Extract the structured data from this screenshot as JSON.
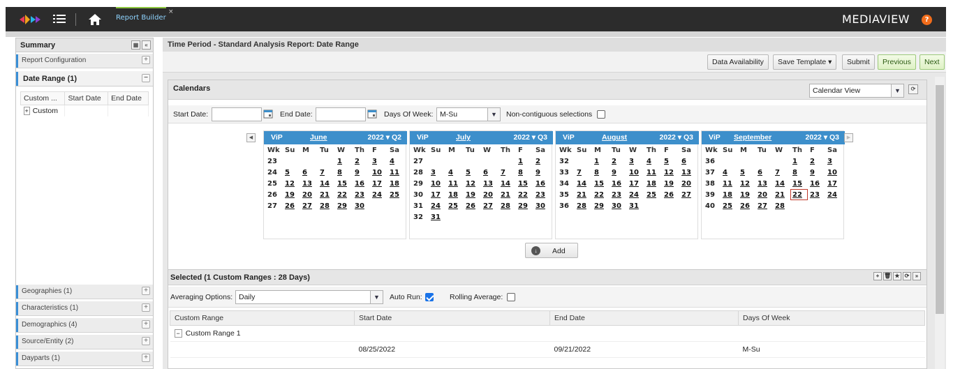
{
  "app": {
    "tab_label": "Report Builder",
    "tab_close": "×",
    "brand": "MEDIAVIEW",
    "help": "?"
  },
  "summary": {
    "title": "Summary",
    "report_config": "Report Configuration",
    "date_range": "Date Range (1)",
    "table_headers": [
      "Custom ...",
      "Start Date",
      "End Date"
    ],
    "table_row": "Custom",
    "sections": [
      "Geographies (1)",
      "Characteristics (1)",
      "Demographics (4)",
      "Source/Entity (2)",
      "Dayparts (1)"
    ]
  },
  "main": {
    "title": "Time Period - Standard Analysis Report: Date Range",
    "buttons": {
      "data_availability": "Data Availability",
      "save_template": "Save Template ▾",
      "submit": "Submit",
      "previous": "Previous",
      "next": "Next"
    }
  },
  "calendars": {
    "title": "Calendars",
    "view": "Calendar View",
    "start_label": "Start Date:",
    "end_label": "End Date:",
    "dow_label": "Days Of Week:",
    "dow_value": "M-Su",
    "noncontig_label": "Non-contiguous selections",
    "add_label": "Add",
    "day_headers": [
      "Wk",
      "Su",
      "M",
      "Tu",
      "W",
      "Th",
      "F",
      "Sa"
    ],
    "months": [
      {
        "vip": "ViP",
        "name": "June",
        "year": "2022 ▾ Q2",
        "weeks": [
          [
            "23",
            "",
            "",
            "",
            "1",
            "2",
            "3",
            "4"
          ],
          [
            "24",
            "5",
            "6",
            "7",
            "8",
            "9",
            "10",
            "11"
          ],
          [
            "25",
            "12",
            "13",
            "14",
            "15",
            "16",
            "17",
            "18"
          ],
          [
            "26",
            "19",
            "20",
            "21",
            "22",
            "23",
            "24",
            "25"
          ],
          [
            "27",
            "26",
            "27",
            "28",
            "29",
            "30",
            "",
            ""
          ]
        ]
      },
      {
        "vip": "ViP",
        "name": "July",
        "year": "2022 ▾ Q3",
        "weeks": [
          [
            "27",
            "",
            "",
            "",
            "",
            "",
            "1",
            "2"
          ],
          [
            "28",
            "3",
            "4",
            "5",
            "6",
            "7",
            "8",
            "9"
          ],
          [
            "29",
            "10",
            "11",
            "12",
            "13",
            "14",
            "15",
            "16"
          ],
          [
            "30",
            "17",
            "18",
            "19",
            "20",
            "21",
            "22",
            "23"
          ],
          [
            "31",
            "24",
            "25",
            "26",
            "27",
            "28",
            "29",
            "30"
          ],
          [
            "32",
            "31",
            "",
            "",
            "",
            "",
            "",
            ""
          ]
        ]
      },
      {
        "vip": "ViP",
        "name": "August",
        "year": "2022 ▾ Q3",
        "weeks": [
          [
            "32",
            "",
            "1",
            "2",
            "3",
            "4",
            "5",
            "6"
          ],
          [
            "33",
            "7",
            "8",
            "9",
            "10",
            "11",
            "12",
            "13"
          ],
          [
            "34",
            "14",
            "15",
            "16",
            "17",
            "18",
            "19",
            "20"
          ],
          [
            "35",
            "21",
            "22",
            "23",
            "24",
            "25",
            "26",
            "27"
          ],
          [
            "36",
            "28",
            "29",
            "30",
            "31",
            "",
            "",
            ""
          ]
        ]
      },
      {
        "vip": "ViP",
        "name": "September",
        "year": "2022 ▾ Q3",
        "weeks": [
          [
            "36",
            "",
            "",
            "",
            "",
            "1",
            "2",
            "3"
          ],
          [
            "37",
            "4",
            "5",
            "6",
            "7",
            "8",
            "9",
            "10"
          ],
          [
            "38",
            "11",
            "12",
            "13",
            "14",
            "15",
            "16",
            "17"
          ],
          [
            "39",
            "18",
            "19",
            "20",
            "21",
            "22",
            "23",
            "24"
          ],
          [
            "40",
            "25",
            "26",
            "27",
            "28",
            "",
            "",
            ""
          ]
        ]
      }
    ],
    "today_month": 3,
    "today_day": "22"
  },
  "selected": {
    "title": "Selected (1 Custom Ranges : 28 Days)",
    "avg_label": "Averaging Options:",
    "avg_value": "Daily",
    "autorun_label": "Auto Run:",
    "rolling_label": "Rolling Average:",
    "headers": [
      "Custom Range",
      "Start Date",
      "End Date",
      "Days Of Week"
    ],
    "group": "Custom Range 1",
    "row": {
      "start": "08/25/2022",
      "end": "09/21/2022",
      "dow": "M-Su"
    }
  }
}
